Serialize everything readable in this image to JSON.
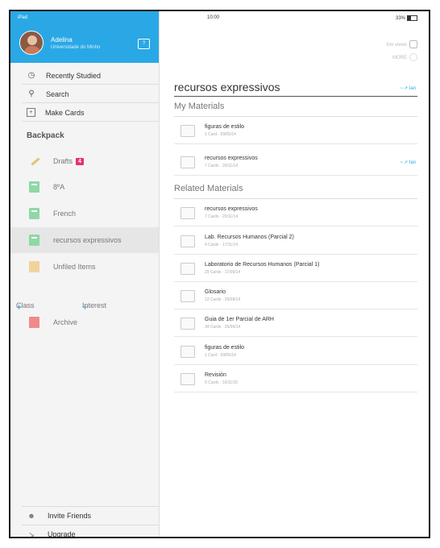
{
  "status": {
    "carrier": "iPad",
    "time": "10:00",
    "battery": "33%"
  },
  "user": {
    "name": "Adelina",
    "school": "Universidade do Minho"
  },
  "nav": [
    {
      "label": "Recently Studied",
      "icon": "clock-icon"
    },
    {
      "label": "Search",
      "icon": "search-icon"
    },
    {
      "label": "Make Cards",
      "icon": "plus-box-icon"
    }
  ],
  "backpack": {
    "title": "Backpack",
    "items": [
      {
        "label": "Drafts",
        "badge": "4",
        "icon": "pencil-icon"
      },
      {
        "label": "8ºA",
        "icon": "class-card-icon"
      },
      {
        "label": "French",
        "icon": "class-card-icon"
      },
      {
        "label": "recursos expressivos",
        "icon": "class-card-icon",
        "selected": true
      },
      {
        "label": "Unfiled Items",
        "icon": "folder-icon"
      }
    ],
    "add_class": "Class",
    "add_interest": "Interest",
    "archive": "Archive"
  },
  "bottom": [
    {
      "label": "Invite Friends",
      "icon": "people-icon"
    },
    {
      "label": "Upgrade",
      "icon": "upgrade-icon"
    }
  ],
  "main": {
    "title": "recursos expressivos",
    "actions": [
      "Ir/o views",
      "MORE"
    ],
    "sync_label": "Ian",
    "my_materials_title": "My Materials",
    "my_materials": [
      {
        "title": "figuras de estilo",
        "meta": "1 Card · 09/05/14"
      },
      {
        "title": "recursos expressivos",
        "meta": "7 Cards · 20/11/14",
        "sync": "Ian"
      }
    ],
    "related_title": "Related Materials",
    "related": [
      {
        "title": "recursos expressivos",
        "meta": "7 Cards · 20/11/14"
      },
      {
        "title": "Lab. Recursos Humanos (Parcial 2)",
        "meta": "4 Cards · 17/11/14"
      },
      {
        "title": "Laboratorio de Recursos Humanos (Parcial 1)",
        "meta": "29 Cards · 17/09/14"
      },
      {
        "title": "Glosario",
        "meta": "12 Cards · 25/09/14"
      },
      {
        "title": "Guia de 1er Parcial de ARH",
        "meta": "34 Cards · 25/09/14"
      },
      {
        "title": "figuras de estilo",
        "meta": "1 Card · 09/05/14"
      },
      {
        "title": "Revisión",
        "meta": "9 Cards · 16/11/15"
      }
    ]
  },
  "colors": {
    "accent": "#2aa8e6",
    "badge": "#e8336b"
  }
}
